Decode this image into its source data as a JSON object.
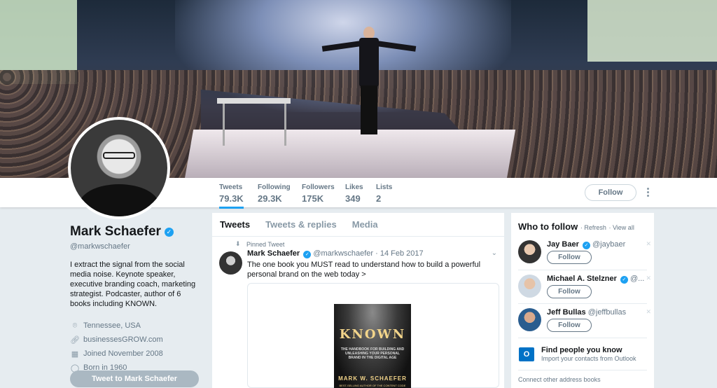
{
  "stats": [
    {
      "label": "Tweets",
      "value": "79.3K"
    },
    {
      "label": "Following",
      "value": "29.3K"
    },
    {
      "label": "Followers",
      "value": "175K"
    },
    {
      "label": "Likes",
      "value": "349"
    },
    {
      "label": "Lists",
      "value": "2"
    }
  ],
  "header": {
    "follow_label": "Follow"
  },
  "profile": {
    "name": "Mark Schaefer",
    "handle": "@markwschaefer",
    "bio": "I extract the signal from the social media noise. Keynote speaker, executive branding coach, marketing strategist. Podcaster, author of 6 books including KNOWN.",
    "location": "Tennessee, USA",
    "website": "businessesGROW.com",
    "joined": "Joined November 2008",
    "born": "Born in 1960",
    "tweet_to_label": "Tweet to Mark Schaefer"
  },
  "timeline": {
    "tabs": [
      "Tweets",
      "Tweets & replies",
      "Media"
    ],
    "pinned_label": "Pinned Tweet",
    "tweet": {
      "author": "Mark Schaefer",
      "handle": "@markwschaefer",
      "date": "· 14 Feb 2017",
      "text": "The one book you MUST read to understand how to build a powerful personal brand on the web today >",
      "book_title": "KNOWN",
      "book_subtitle": "THE HANDBOOK FOR BUILDING AND UNLEASHING YOUR PERSONAL BRAND IN THE DIGITAL AGE",
      "book_author": "MARK W. SCHAEFER",
      "book_tagline": "BEST-SELLING AUTHOR OF THE CONTENT CODE"
    }
  },
  "who_to_follow": {
    "title": "Who to follow",
    "refresh": "· Refresh",
    "view_all": "· View all",
    "follow_label": "Follow",
    "suggestions": [
      {
        "name": "Jay Baer",
        "handle": "@jaybaer",
        "verified": true
      },
      {
        "name": "Michael A. Stelzner",
        "handle": "@...",
        "verified": true
      },
      {
        "name": "Jeff Bullas",
        "handle": "@jeffbullas",
        "verified": false
      }
    ],
    "find_title": "Find people you know",
    "find_sub": "Import your contacts from Outlook",
    "connect": "Connect other address books"
  },
  "colors": {
    "accent": "#1da1f2",
    "text_secondary": "#657786",
    "background": "#e6ecf0"
  },
  "icons": {
    "location": "location-pin-icon",
    "link": "link-icon",
    "calendar": "calendar-icon",
    "balloon": "balloon-icon",
    "verified": "verified-badge-icon",
    "pin": "pin-icon",
    "more": "more-dots-icon",
    "close": "close-icon",
    "outlook": "outlook-icon"
  }
}
